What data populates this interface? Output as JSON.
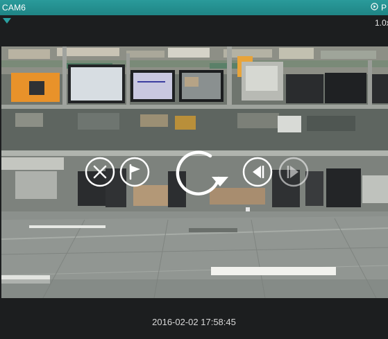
{
  "header": {
    "camera_name": "CAM6",
    "play_mode_label": "P",
    "speed": "1.0x"
  },
  "controls": {
    "close": "close-icon",
    "bookmark": "flag-icon",
    "refresh": "rotate-icon",
    "step_back": "step-back-icon",
    "step_forward": "step-forward-icon"
  },
  "footer": {
    "timestamp": "2016-02-02 17:58:45"
  },
  "colors": {
    "header_bar": "#1f8585",
    "background": "#1c1e1f",
    "control_stroke": "#ffffff"
  }
}
